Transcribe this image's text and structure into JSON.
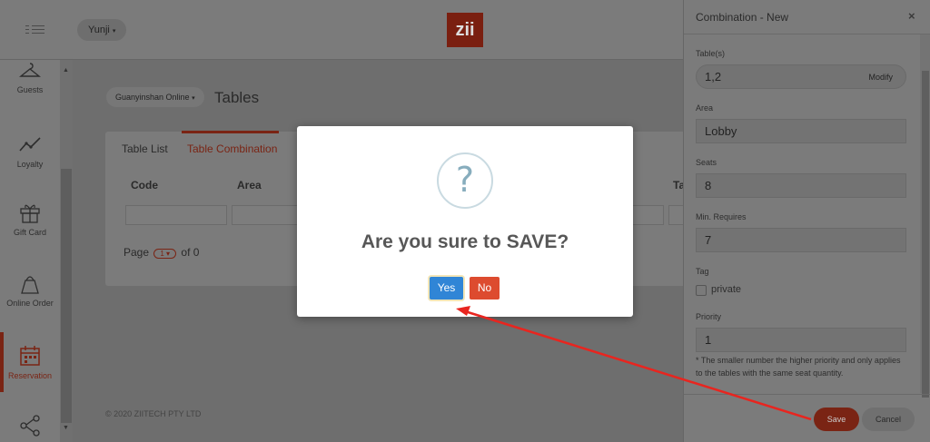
{
  "header": {
    "user": "Yunji",
    "logo_text": "zii"
  },
  "sidebar": {
    "items": [
      {
        "label": "Guests",
        "icon": "hanger-icon"
      },
      {
        "label": "Loyalty",
        "icon": "trend-icon"
      },
      {
        "label": "Gift Card",
        "icon": "gift-icon"
      },
      {
        "label": "Online Order",
        "icon": "bag-icon"
      },
      {
        "label": "Reservation",
        "icon": "calendar-icon"
      },
      {
        "label": "",
        "icon": "share-icon"
      }
    ]
  },
  "main": {
    "shop": "Guanyinshan Online",
    "title": "Tables",
    "tabs": [
      "Table List",
      "Table Combination"
    ],
    "columns": [
      "Code",
      "Area",
      "Ta"
    ],
    "pager": {
      "prefix": "Page",
      "page": "1",
      "suffix": "of 0"
    },
    "footer": "© 2020 ZIITECH PTY LTD"
  },
  "drawer": {
    "title": "Combination - New",
    "close": "×",
    "tables_label": "Table(s)",
    "tables_value": "1,2",
    "modify_label": "Modify",
    "area_label": "Area",
    "area_value": "Lobby",
    "seats_label": "Seats",
    "seats_value": "8",
    "min_label": "Min. Requires",
    "min_value": "7",
    "tag_label": "Tag",
    "tag_option": "private",
    "priority_label": "Priority",
    "priority_value": "1",
    "hint": "* The smaller number the higher priority and only applies to the tables with the same seat quantity.",
    "save": "Save",
    "cancel": "Cancel"
  },
  "dialog": {
    "icon": "?",
    "title": "Are you sure to SAVE?",
    "yes": "Yes",
    "no": "No"
  },
  "colors": {
    "accent": "#dd4b2f",
    "primary": "#3085d6",
    "annotation": "#e8251f"
  }
}
